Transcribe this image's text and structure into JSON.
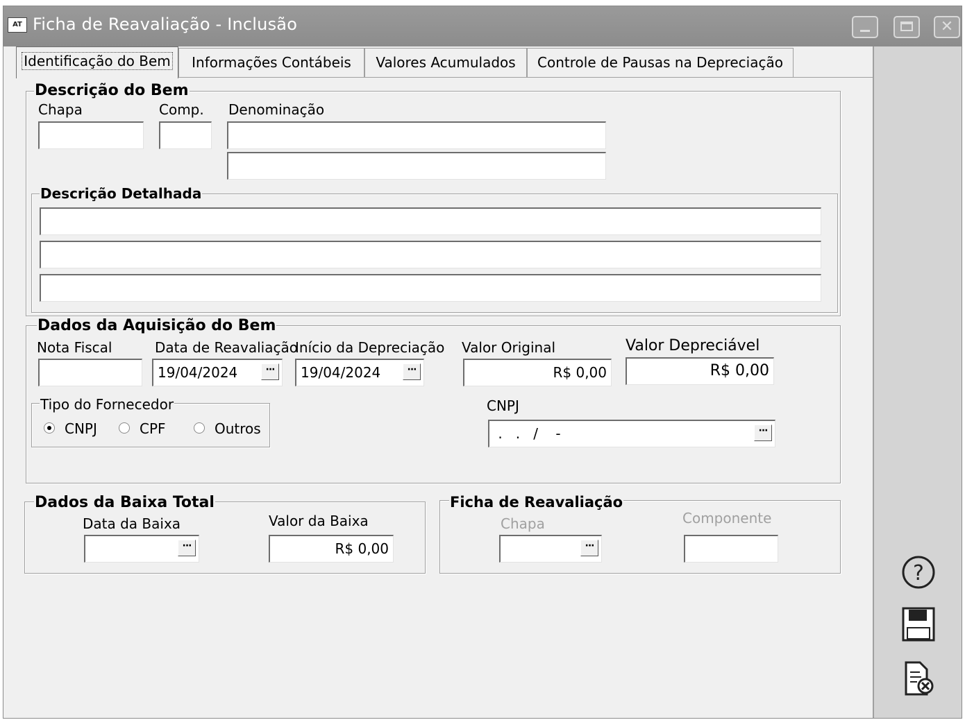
{
  "window": {
    "icon_text": "AT",
    "title": "Ficha de Reavaliação - Inclusão",
    "close_label": "✕"
  },
  "tabs": [
    {
      "label": "Identificação do Bem"
    },
    {
      "label": "Informações Contábeis"
    },
    {
      "label": "Valores Acumulados"
    },
    {
      "label": "Controle de Pausas na Depreciação"
    }
  ],
  "descricao": {
    "title": "Descrição  do Bem",
    "chapa_label": "Chapa",
    "comp_label": "Comp.",
    "denominacao_label": "Denominação",
    "detalhada_title": "Descrição Detalhada"
  },
  "aquisicao": {
    "title": "Dados da Aquisição do Bem",
    "nota_fiscal_label": "Nota Fiscal",
    "data_reavaliacao_label": "Data de Reavaliação",
    "data_reavaliacao_value": "19/04/2024",
    "inicio_depreciacao_label": "Início da Depreciação",
    "inicio_depreciacao_value": "19/04/2024",
    "valor_original_label": "Valor Original",
    "valor_original_value": "R$ 0,00",
    "valor_depreciavel_label": "Valor Depreciável",
    "valor_depreciavel_value": "R$ 0,00",
    "tipo_fornecedor_title": "Tipo do Fornecedor",
    "radio_cnpj": "CNPJ",
    "radio_cpf": "CPF",
    "radio_outros": "Outros",
    "cnpj_label": "CNPJ",
    "cnpj_mask": " .   .   /    -"
  },
  "baixa": {
    "title": "Dados da Baixa Total",
    "data_label": "Data da Baixa",
    "valor_label": "Valor da Baixa",
    "valor_value": "R$ 0,00"
  },
  "ficha": {
    "title": "Ficha de Reavaliação",
    "chapa_label": "Chapa",
    "componente_label": "Componente"
  },
  "dots": "···"
}
